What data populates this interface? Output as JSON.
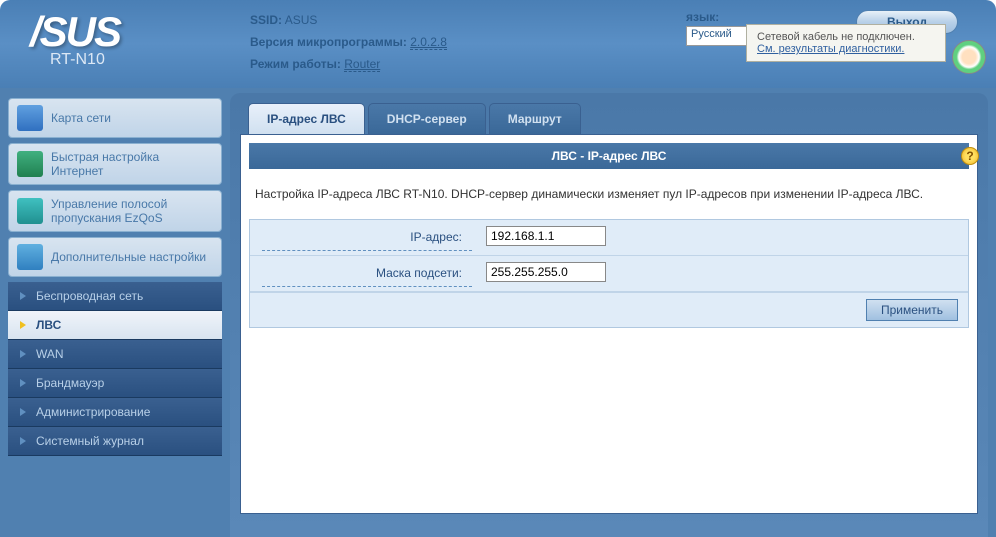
{
  "header": {
    "brand": "/SUS",
    "model": "RT-N10",
    "ssid_label": "SSID:",
    "ssid_value": "ASUS",
    "fw_label": "Версия микропрограммы:",
    "fw_value": "2.0.2.8",
    "mode_label": "Режим работы:",
    "mode_value": "Router",
    "lang_label": "язык:",
    "lang_value": "Русский",
    "logout": "Выход",
    "tooltip_line1": "Сетевой кабель не подключен.",
    "tooltip_link": "См. результаты диагностики."
  },
  "sidebar": {
    "items": [
      {
        "label": "Карта сети"
      },
      {
        "label": "Быстрая настройка Интернет"
      },
      {
        "label": "Управление полосой пропускания EzQoS"
      },
      {
        "label": "Дополнительные настройки"
      }
    ],
    "sub": [
      {
        "label": "Беспроводная сеть"
      },
      {
        "label": "ЛВС"
      },
      {
        "label": "WAN"
      },
      {
        "label": "Брандмауэр"
      },
      {
        "label": "Администрирование"
      },
      {
        "label": "Системный журнал"
      }
    ]
  },
  "tabs": [
    {
      "label": "IP-адрес ЛВС"
    },
    {
      "label": "DHCP-сервер"
    },
    {
      "label": "Маршрут"
    }
  ],
  "panel": {
    "title": "ЛВС - IP-адрес ЛВС",
    "description": "Настройка IP-адреса ЛВС RT-N10. DHCP-сервер динамически изменяет пул IP-адресов при изменении IP-адреса ЛВС.",
    "ip_label": "IP-адрес:",
    "ip_value": "192.168.1.1",
    "mask_label": "Маска подсети:",
    "mask_value": "255.255.255.0",
    "apply": "Применить",
    "help": "?"
  }
}
